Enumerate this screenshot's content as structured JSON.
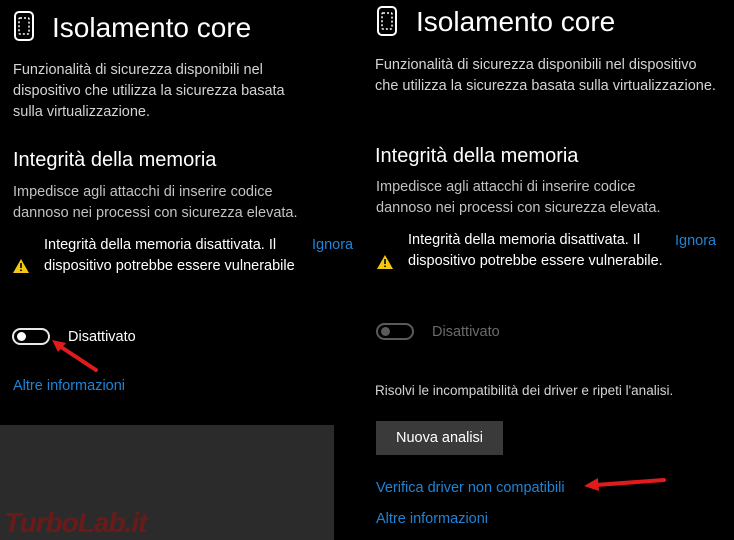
{
  "left": {
    "title": "Isolamento core",
    "description": "Funzionalità di sicurezza disponibili nel dispositivo che utilizza la sicurezza basata sulla virtualizzazione.",
    "section_title": "Integrità della memoria",
    "section_description": "Impedisce agli attacchi di inserire codice dannoso nei processi con sicurezza elevata.",
    "warning": "Integrità della memoria disattivata. Il dispositivo potrebbe essere vulnerabile",
    "dismiss": "Ignora",
    "toggle_label": "Disattivato",
    "more_info": "Altre informazioni"
  },
  "right": {
    "title": "Isolamento core",
    "description": "Funzionalità di sicurezza disponibili nel dispositivo che utilizza la sicurezza basata sulla virtualizzazione.",
    "section_title": "Integrità della memoria",
    "section_description": "Impedisce agli attacchi di inserire codice dannoso nei processi con sicurezza elevata.",
    "warning": "Integrità della memoria disattivata. Il dispositivo potrebbe essere vulnerabile.",
    "dismiss": "Ignora",
    "toggle_label": "Disattivato",
    "resolve_text": "Risolvi le incompatibilità dei driver e ripeti l'analisi.",
    "scan_button": "Nuova analisi",
    "verify_link": "Verifica driver non compatibili",
    "more_info": "Altre informazioni"
  },
  "watermark": "TurboLab.it",
  "colors": {
    "background": "#000000",
    "link": "#1f84d6",
    "warning_icon": "#f2c811",
    "arrow": "#e01b1b",
    "button": "#3a3a3a"
  },
  "icons": [
    "device-shield-icon",
    "warning-icon"
  ]
}
